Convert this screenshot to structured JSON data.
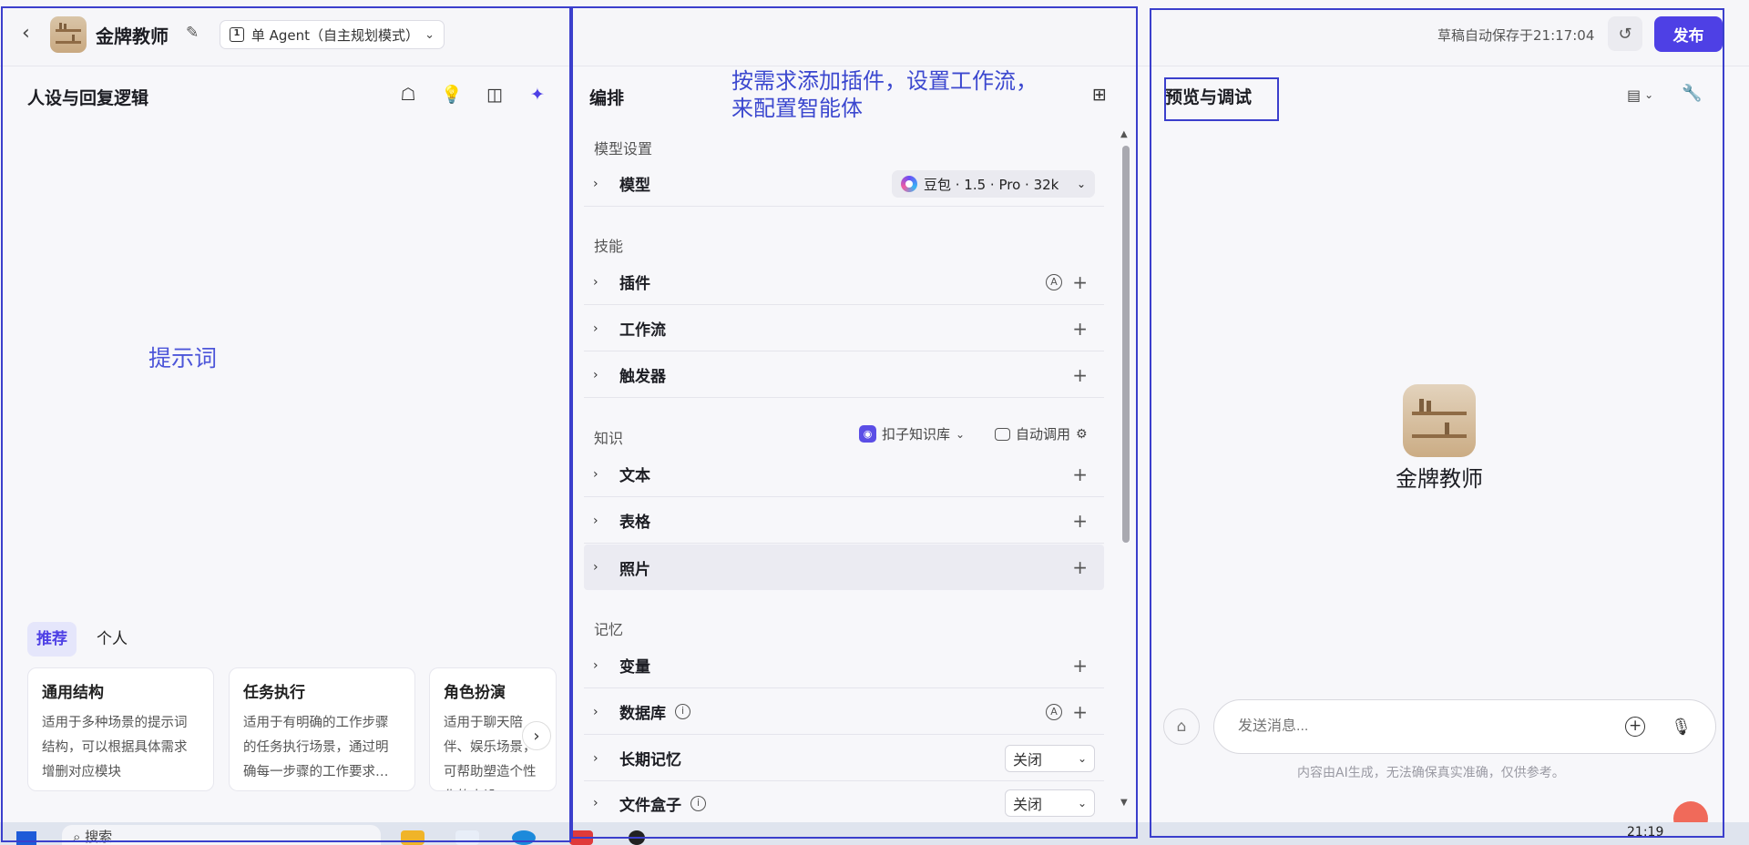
{
  "header": {
    "bot_name": "金牌教师",
    "mode_label": "单 Agent（自主规划模式）",
    "save_status": "草稿自动保存于21:17:04",
    "publish_label": "发布"
  },
  "left": {
    "title": "人设与回复逻辑",
    "prompt_annotation": "提示词",
    "tabs": [
      "推荐",
      "个人"
    ],
    "cards": [
      {
        "title": "通用结构",
        "desc": "适用于多种场景的提示词结构，可以根据具体需求增删对应模块"
      },
      {
        "title": "任务执行",
        "desc": "适用于有明确的工作步骤的任务执行场景，通过明确每一步骤的工作要求…"
      },
      {
        "title": "角色扮演",
        "desc": "适用于聊天陪伴、娱乐场景，可帮助塑造个性化的人设"
      }
    ]
  },
  "middle": {
    "title": "编排",
    "annotation_line1": "按需求添加插件，设置工作流，",
    "annotation_line2": "来配置智能体",
    "sections": {
      "model": "模型设置",
      "skills": "技能",
      "knowledge": "知识",
      "memory": "记忆"
    },
    "model_row": "模型",
    "model_value": "豆包 · 1.5 · Pro · 32k",
    "skill_rows": [
      "插件",
      "工作流",
      "触发器"
    ],
    "knowledge_source": "扣子知识库",
    "knowledge_mode": "自动调用",
    "knowledge_rows": [
      "文本",
      "表格",
      "照片"
    ],
    "memory_rows": [
      "变量",
      "数据库",
      "长期记忆",
      "文件盒子"
    ],
    "off_label": "关闭"
  },
  "right": {
    "title": "预览与调试",
    "preview_name": "金牌教师",
    "input_placeholder": "发送消息...",
    "disclaimer": "内容由AI生成，无法确保真实准确，仅供参考。"
  },
  "taskbar": {
    "search": "搜索",
    "clock": "21:19"
  },
  "colors": {
    "accent": "#4e40e5",
    "annotation": "#3b3fcc"
  },
  "icons": [
    "back-icon",
    "edit-icon",
    "mode-icon",
    "history-icon",
    "persona-icon",
    "bulb-icon",
    "split-icon",
    "sparkle-icon",
    "grid-icon",
    "chevron-right-icon",
    "plus-icon",
    "info-icon",
    "auto-icon",
    "settings-icon",
    "wrench-icon",
    "mic-icon",
    "broom-icon"
  ]
}
